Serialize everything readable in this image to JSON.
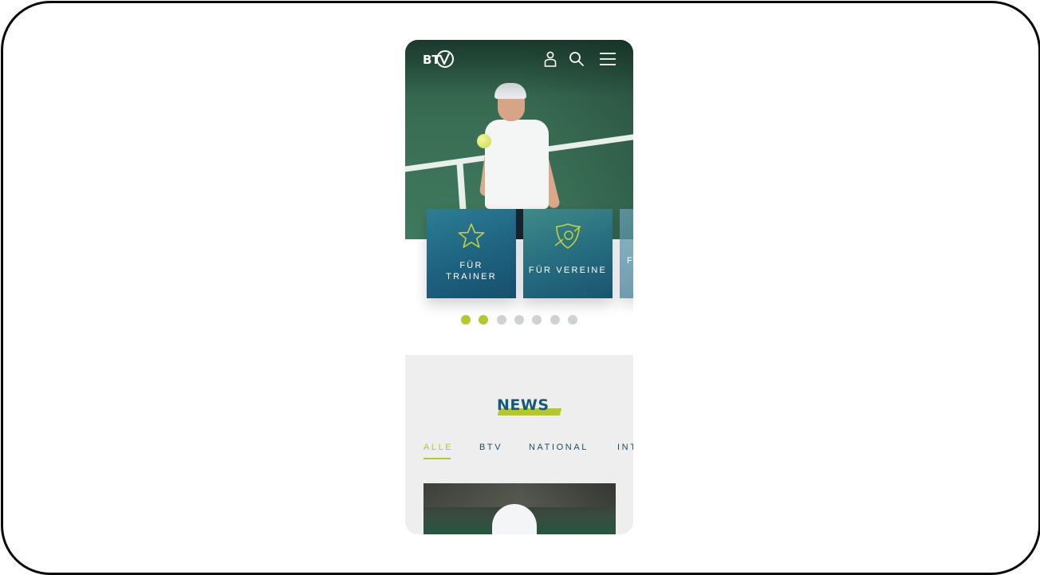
{
  "brand": {
    "logo_text": "BT",
    "accent": "#b6c633",
    "primary": "#155a78"
  },
  "header": {
    "icons": [
      "user-icon",
      "search-icon",
      "menu-icon"
    ]
  },
  "cards": [
    {
      "label_line1": "FÜR",
      "label_line2": "TRAINER",
      "icon": "star-icon"
    },
    {
      "label": "FÜR VEREINE",
      "icon": "shield-ball-icon"
    },
    {
      "label_partial": "F"
    }
  ],
  "carousel": {
    "dot_count": 7,
    "active_dots": [
      0,
      1
    ]
  },
  "news": {
    "title": "NEWS",
    "tabs": [
      "ALLE",
      "BTV",
      "NATIONAL",
      "INT"
    ],
    "active_tab": "ALLE"
  }
}
